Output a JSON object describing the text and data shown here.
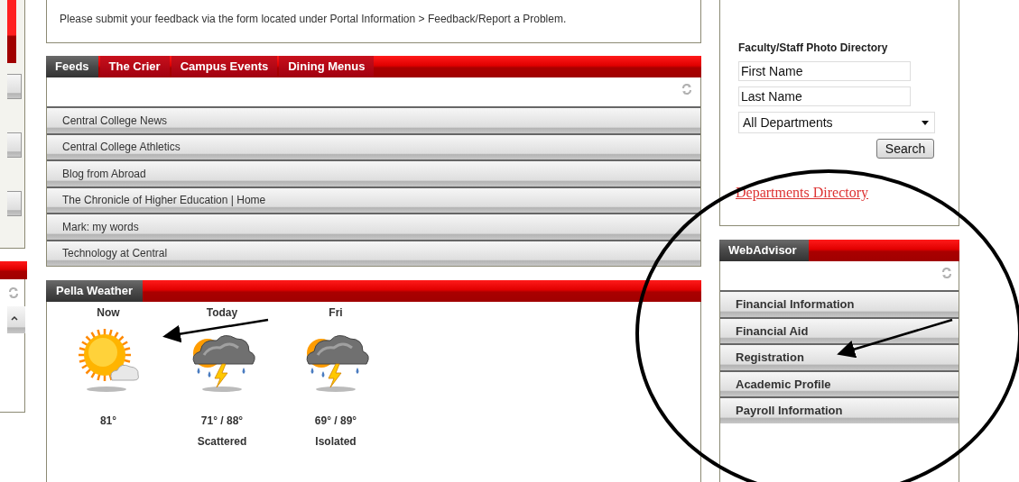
{
  "notice": {
    "text": "Please submit your feedback via the form located under Portal Information > Feedback/Report a Problem."
  },
  "feeds": {
    "tabs": [
      {
        "label": "Feeds",
        "selected": true
      },
      {
        "label": "The Crier",
        "selected": false
      },
      {
        "label": "Campus Events",
        "selected": false
      },
      {
        "label": "Dining Menus",
        "selected": false
      }
    ],
    "items": [
      "Central College News",
      "Central College Athletics",
      "Blog from Abroad",
      "The Chronicle of Higher Education | Home",
      "Mark: my words",
      "Technology at Central"
    ]
  },
  "weather": {
    "title": "Pella Weather",
    "days": [
      {
        "label": "Now",
        "kind": "sun-cloud",
        "temp": "81°"
      },
      {
        "label": "Today",
        "kind": "storm",
        "temp": "71° / 88°",
        "summary": "Scattered"
      },
      {
        "label": "Fri",
        "kind": "storm",
        "temp": "69° / 89°",
        "summary": "Isolated"
      }
    ]
  },
  "directory": {
    "title": "Faculty/Staff Photo Directory",
    "first_name": "First Name",
    "last_name": "Last Name",
    "department": "All Departments",
    "button": "Search",
    "link": "Departments Directory"
  },
  "webadvisor": {
    "title": "WebAdvisor",
    "items": [
      "Financial Information",
      "Financial Aid",
      "Registration",
      "Academic Profile",
      "Payroll Information"
    ]
  }
}
